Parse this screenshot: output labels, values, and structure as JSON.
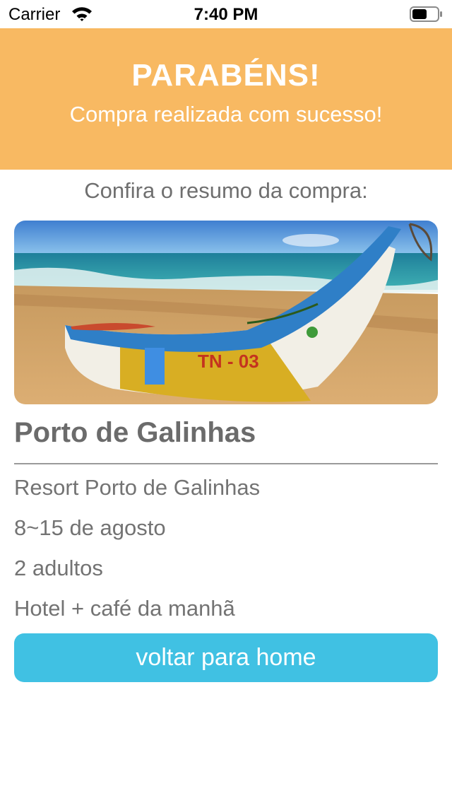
{
  "status_bar": {
    "carrier": "Carrier",
    "time": "7:40 PM",
    "wifi_icon": "wifi-icon",
    "battery_icon": "battery-icon"
  },
  "banner": {
    "title": "PARABÉNS!",
    "subtitle": "Compra realizada com sucesso!",
    "background_color": "#f8b962"
  },
  "summary": {
    "label": "Confira o resumo da compra:",
    "photo": "beach-boat-photo",
    "destination": "Porto de Galinhas",
    "details": [
      "Resort Porto de Galinhas",
      "8~15 de agosto",
      "2 adultos",
      "Hotel + café da manhã"
    ]
  },
  "actions": {
    "home_button_label": "voltar para home",
    "button_color": "#40c1e3"
  }
}
